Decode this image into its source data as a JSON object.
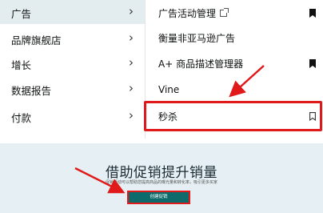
{
  "left_menu": {
    "items": [
      {
        "label": "广告",
        "chevron": "›",
        "active": true
      },
      {
        "label": "品牌旗舰店",
        "chevron": "›",
        "active": false
      },
      {
        "label": "增长",
        "chevron": "›",
        "active": false
      },
      {
        "label": "数据报告",
        "chevron": "›",
        "active": false
      },
      {
        "label": "付款",
        "chevron": "›",
        "active": false
      }
    ]
  },
  "submenu": {
    "items": [
      {
        "label": "广告活动管理",
        "external_icon": "external-link-icon",
        "bookmark": "bookmark-filled-icon"
      },
      {
        "label": "衡量非亚马逊广告"
      },
      {
        "label": "A+ 商品描述管理器",
        "bookmark": "bookmark-filled-icon"
      },
      {
        "label": "Vine"
      },
      {
        "label": "秒杀",
        "bookmark": "bookmark-outline-icon",
        "highlighted": true
      }
    ]
  },
  "banner": {
    "title": "借助促销提升销量",
    "description": "促销活动可以帮助您提高商品的曝光量和转化率，吸引更多买家",
    "cta_label": "创建促销"
  },
  "colors": {
    "highlight": "#e0191b",
    "active_bg": "#e3ecef",
    "banner_bg": "#e6f0f4",
    "cta_bg": "#0e6b6b"
  }
}
